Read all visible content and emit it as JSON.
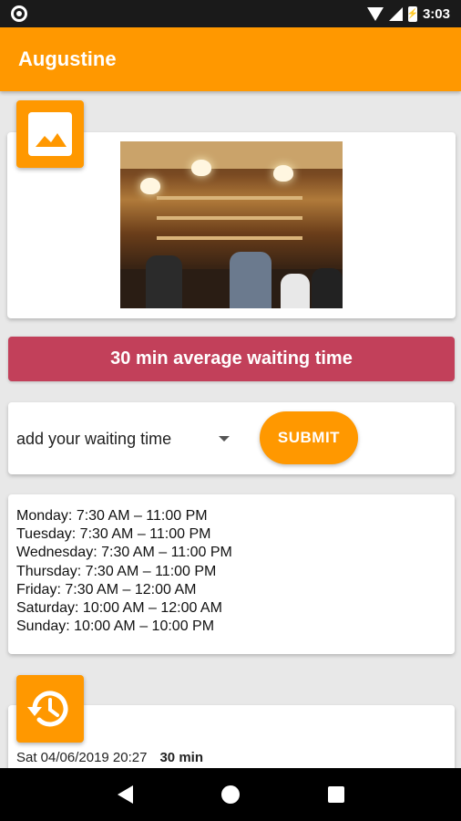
{
  "status_bar": {
    "time": "3:03",
    "icons": [
      "circle-notification-icon",
      "wifi-icon",
      "signal-icon",
      "battery-icon"
    ],
    "battery_glyph": "⚡"
  },
  "app_bar": {
    "title": "Augustine",
    "color": "#ff9800"
  },
  "image_section": {
    "fab_icon": "image-icon",
    "photo": "bar-interior-photo"
  },
  "waiting_banner": {
    "text": "30 min average waiting time",
    "color": "#c2405a"
  },
  "waiting_input": {
    "placeholder": "add your waiting time",
    "submit_label": "SUBMIT"
  },
  "opening_hours": [
    "Monday: 7:30 AM – 11:00 PM",
    "Tuesday: 7:30 AM – 11:00 PM",
    "Wednesday: 7:30 AM – 11:00 PM",
    "Thursday: 7:30 AM – 11:00 PM",
    "Friday: 7:30 AM – 12:00 AM",
    "Saturday: 10:00 AM – 12:00 AM",
    "Sunday: 10:00 AM – 10:00 PM"
  ],
  "history": {
    "fab_icon": "history-icon",
    "entries": [
      {
        "timestamp": "Sat 04/06/2019 20:27",
        "duration": "30 min"
      }
    ]
  },
  "nav_bar": {
    "icons": [
      "back-icon",
      "home-icon",
      "recents-icon"
    ]
  }
}
